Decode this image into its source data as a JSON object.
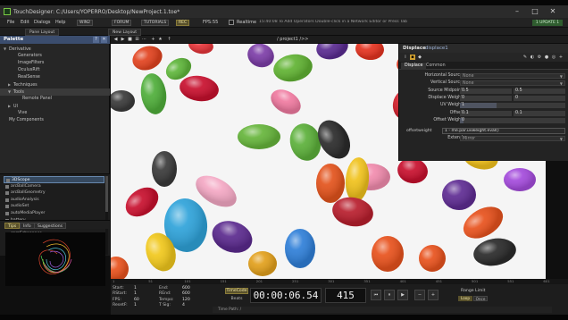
{
  "window": {
    "title": "TouchDesigner: C:/Users/YOPERRO/Desktop/NewProject.1.toe*",
    "minimize": "–",
    "maximize": "□",
    "close": "✕"
  },
  "menu": {
    "items": [
      "File",
      "Edit",
      "Dialogs",
      "Help"
    ],
    "boxes": [
      "WIN2",
      "FORUM",
      "TUTORIALS"
    ],
    "record_badge": "REC",
    "fps_label": "FPS:",
    "fps_value": "55",
    "realtime_label": "Realtime",
    "status": "15:40:08 To Add Operators Double-click in a Network Editor or Press Tab",
    "update_badge": "1 UPDATE 1"
  },
  "tabs": {
    "pane_layout": "Pane Layout",
    "new_layout": "New Layout"
  },
  "palette": {
    "title": "Palette",
    "tree": [
      {
        "label": "Derivative",
        "indent": 0,
        "arrow": "▼"
      },
      {
        "label": "Generators",
        "indent": 2,
        "arrow": ""
      },
      {
        "label": "ImageFilters",
        "indent": 2,
        "arrow": ""
      },
      {
        "label": "OculusRift",
        "indent": 2,
        "arrow": ""
      },
      {
        "label": "RealSense",
        "indent": 2,
        "arrow": ""
      },
      {
        "label": "Techniques",
        "indent": 1,
        "arrow": "▶"
      },
      {
        "label": "Tools",
        "indent": 1,
        "arrow": "▼"
      },
      {
        "label": "Remote Panel",
        "indent": 3,
        "arrow": ""
      },
      {
        "label": "UI",
        "indent": 1,
        "arrow": "▶"
      },
      {
        "label": "Vive",
        "indent": 2,
        "arrow": ""
      },
      {
        "label": "My Components",
        "indent": 0,
        "arrow": ""
      }
    ],
    "tox_items": [
      "3DScope",
      "arcBallCamera",
      "arcBallGeometry",
      "audioAnalysis",
      "audioSet",
      "autoMediaPlayer",
      "battery",
      "blendModes",
      "camSchnapper",
      "chromaKey",
      "customAttributes"
    ],
    "help_buttons": [
      "Tips",
      "Info",
      "Suggestions"
    ]
  },
  "network": {
    "path": "/ project1 />>",
    "buttons": [
      "◀",
      "▶",
      "■",
      "⊞",
      "⋯",
      "+",
      "★",
      "↑"
    ]
  },
  "params": {
    "op_type": "Displace",
    "op_name": "displace1",
    "tabs": [
      "Displace",
      "Common"
    ],
    "rows": [
      {
        "label": "Horizontal Source",
        "value": "None",
        "kind": "drop"
      },
      {
        "label": "Vertical Source",
        "value": "None",
        "kind": "drop"
      },
      {
        "label": "Source Midpoint",
        "v1": "0.5",
        "v2": "0.5",
        "kind": "pair"
      },
      {
        "label": "Displace Weight",
        "v1": "0",
        "v2": "0",
        "kind": "pair"
      },
      {
        "label": "UV Weight",
        "v1": "1",
        "kind": "single"
      },
      {
        "label": "Offset",
        "v1": "0.1",
        "v2": "0.1",
        "kind": "pair"
      },
      {
        "label": "Offset Weight",
        "v1": "0",
        "kind": "single"
      }
    ],
    "expr_label": "offsetweight",
    "expr_value": "1 - me.par.uvweight.eval()",
    "extend_label": "Extend",
    "extend_value": "Mirror"
  },
  "ruler_ticks": [
    "1",
    "51",
    "101",
    "151",
    "201",
    "251",
    "301",
    "351",
    "401",
    "451",
    "501",
    "551",
    "601"
  ],
  "timeline": {
    "left": [
      {
        "label": "Start:",
        "value": "1"
      },
      {
        "label": "RStart:",
        "value": "1"
      },
      {
        "label": "FPS:",
        "value": "60"
      },
      {
        "label": "ResetF:",
        "value": "1"
      }
    ],
    "right": [
      {
        "label": "End:",
        "value": "600"
      },
      {
        "label": "REnd:",
        "value": "600"
      },
      {
        "label": "Tempo:",
        "value": "120"
      },
      {
        "label": "T Sig:",
        "value": "4"
      }
    ],
    "timecode_btn": "TimeCode",
    "beats_btn": "Beats",
    "timecode": "00:00:06.54",
    "frame": "415",
    "range_label": "Range Limit",
    "loop": "Loop",
    "once": "Once",
    "timepath": "Time Path: /"
  },
  "colors": {
    "accent": "#3b4d6e",
    "highlight": "#59512b",
    "update": "#2f5d2f"
  }
}
